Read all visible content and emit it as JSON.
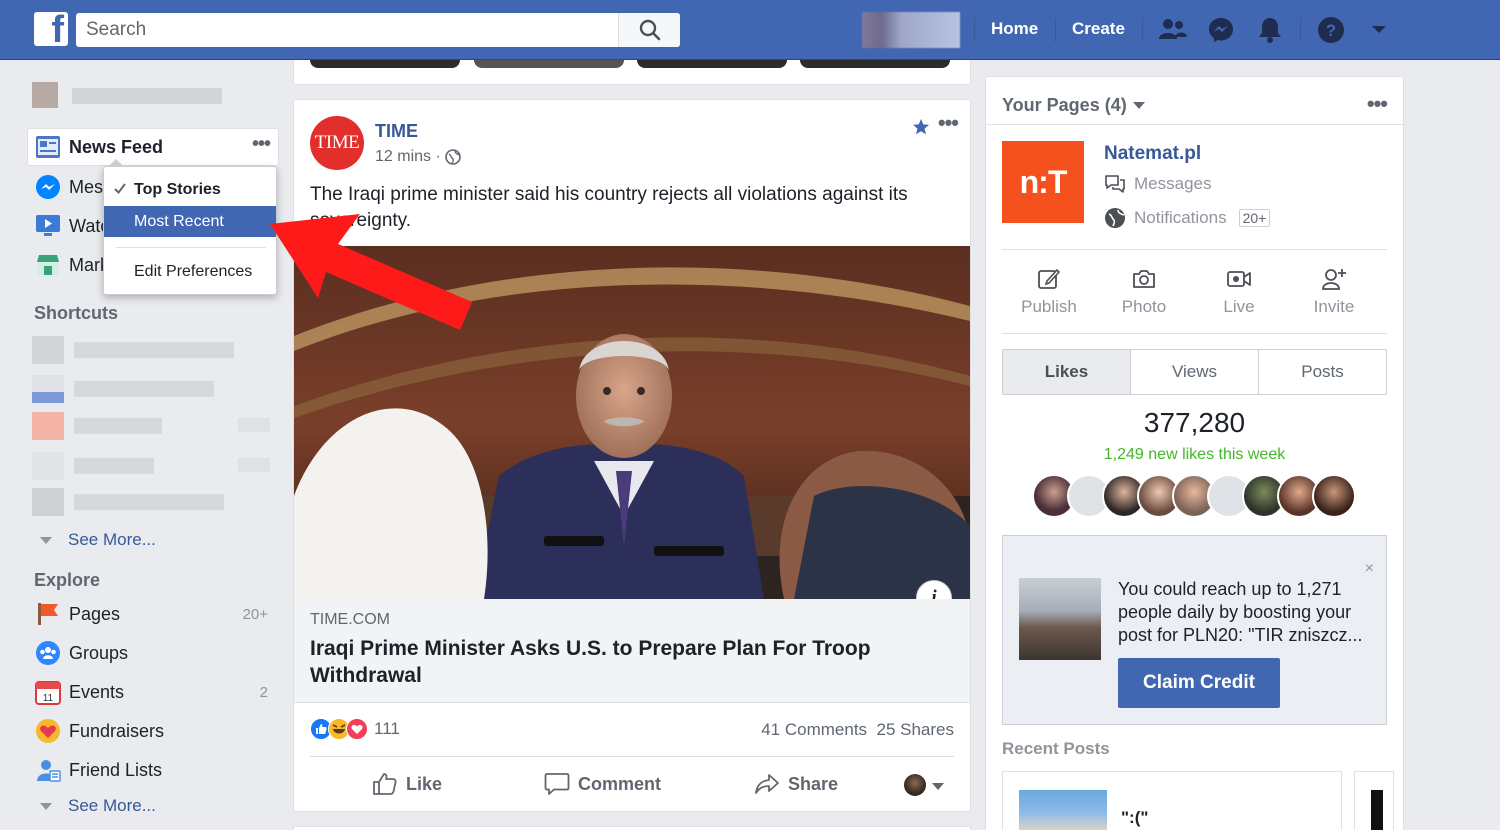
{
  "topbar": {
    "logo_letter": "f",
    "search_placeholder": "Search",
    "nav": [
      "Home",
      "Create"
    ]
  },
  "sidebar": {
    "active": {
      "label": "News Feed"
    },
    "items": [
      {
        "label": "Mes",
        "icon": "messenger-icon"
      },
      {
        "label": "Watc",
        "icon": "watch-icon"
      },
      {
        "label": "Mark",
        "icon": "marketplace-icon"
      }
    ],
    "shortcuts_heading": "Shortcuts",
    "see_more": "See More...",
    "explore_heading": "Explore",
    "explore": [
      {
        "label": "Pages",
        "count": "20+",
        "icon": "flag-icon"
      },
      {
        "label": "Groups",
        "count": "",
        "icon": "groups-icon"
      },
      {
        "label": "Events",
        "count": "2",
        "icon": "calendar-icon"
      },
      {
        "label": "Fundraisers",
        "count": "",
        "icon": "fundraiser-icon"
      },
      {
        "label": "Friend Lists",
        "count": "",
        "icon": "friend-list-icon"
      }
    ],
    "see_more_2": "See More..."
  },
  "dropdown": {
    "items": [
      "Top Stories",
      "Most Recent",
      "Edit Preferences"
    ]
  },
  "post": {
    "avatar_text": "TIME",
    "author": "TIME",
    "time": "12 mins ·",
    "text": "The Iraqi prime minister said his country rejects all violations against its sovereignty.",
    "info": "i",
    "link_domain": "TIME.COM",
    "link_title": "Iraqi Prime Minister Asks U.S. to Prepare Plan For Troop Withdrawal",
    "reaction_count": "111",
    "comments": "41 Comments",
    "shares": "25 Shares",
    "actions": [
      "Like",
      "Comment",
      "Share"
    ]
  },
  "right": {
    "header": "Your Pages (4)",
    "page_logo": "n:T",
    "page_name": "Natemat.pl",
    "messages": "Messages",
    "notifications": "Notifications",
    "notifications_badge": "20+",
    "actions": [
      "Publish",
      "Photo",
      "Live",
      "Invite"
    ],
    "tabs": [
      "Likes",
      "Views",
      "Posts"
    ],
    "likes_count": "377,280",
    "likes_new": "1,249 new likes this week",
    "boost_text": "You could reach up to 1,271 people daily by boosting your post for PLN20: \"TIR zniszcz...",
    "boost_close": "×",
    "claim_button": "Claim Credit",
    "recent_heading": "Recent Posts",
    "recent_text": "\":(\""
  },
  "colors": {
    "brand": "#4267b2",
    "link": "#385898",
    "arrow": "#ff1a1a",
    "green": "#42b72a"
  }
}
